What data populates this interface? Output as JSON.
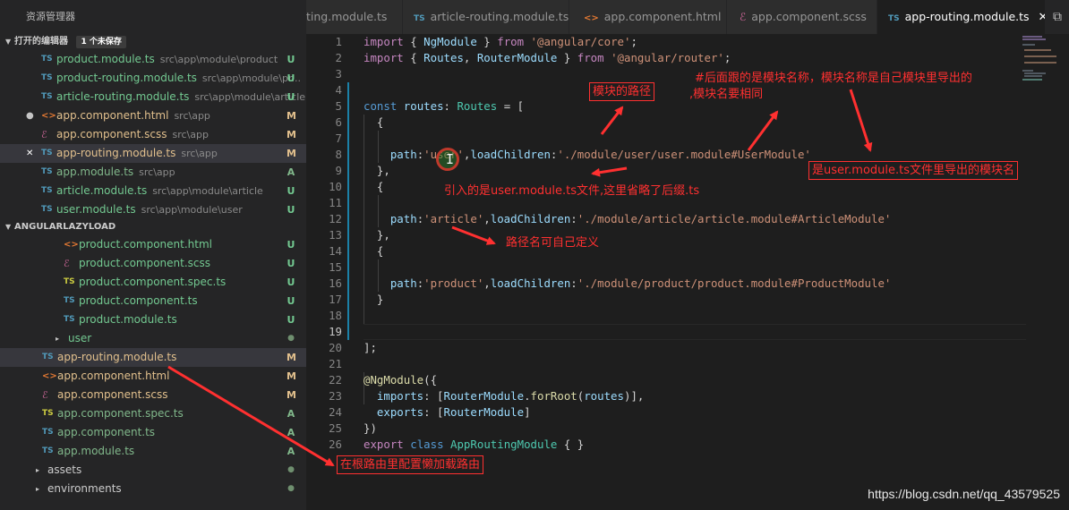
{
  "sidebar": {
    "title": "资源管理器",
    "open_editors": {
      "header": "打开的编辑器",
      "badge": "1 个未保存",
      "items": [
        {
          "icon": "TS",
          "name": "product.module.ts",
          "path": "src\\app\\module\\product",
          "status": "U"
        },
        {
          "icon": "TS",
          "name": "product-routing.module.ts",
          "path": "src\\app\\module\\pr...",
          "status": "U"
        },
        {
          "icon": "TS",
          "name": "article-routing.module.ts",
          "path": "src\\app\\module\\article",
          "status": "U"
        },
        {
          "icon": "<>",
          "mark": "●",
          "name": "app.component.html",
          "path": "src\\app",
          "status": "M"
        },
        {
          "icon": "ℰ",
          "name": "app.component.scss",
          "path": "src\\app",
          "status": "M"
        },
        {
          "icon": "TS",
          "mark": "✕",
          "name": "app-routing.module.ts",
          "path": "src\\app",
          "status": "M"
        },
        {
          "icon": "TS",
          "name": "app.module.ts",
          "path": "src\\app",
          "status": "A"
        },
        {
          "icon": "TS",
          "name": "article.module.ts",
          "path": "src\\app\\module\\article",
          "status": "U"
        },
        {
          "icon": "TS",
          "name": "user.module.ts",
          "path": "src\\app\\module\\user",
          "status": "U"
        }
      ]
    },
    "project": {
      "header": "ANGULARLAZYLOAD",
      "items": [
        {
          "icon": "<>",
          "name": "product.component.html",
          "status": "U"
        },
        {
          "icon": "ℰ",
          "name": "product.component.scss",
          "status": "U"
        },
        {
          "icon": "TS",
          "name": "product.component.spec.ts",
          "status": "U"
        },
        {
          "icon": "TS",
          "name": "product.component.ts",
          "status": "U"
        },
        {
          "icon": "TS",
          "name": "product.module.ts",
          "status": "U"
        },
        {
          "icon": "▸",
          "name": "user",
          "status": "●"
        },
        {
          "icon": "TS",
          "name": "app-routing.module.ts",
          "status": "M"
        },
        {
          "icon": "<>",
          "name": "app.component.html",
          "status": "M"
        },
        {
          "icon": "ℰ",
          "name": "app.component.scss",
          "status": "M"
        },
        {
          "icon": "TS",
          "name": "app.component.spec.ts",
          "status": "A"
        },
        {
          "icon": "TS",
          "name": "app.component.ts",
          "status": "A"
        },
        {
          "icon": "TS",
          "name": "app.module.ts",
          "status": "A"
        },
        {
          "icon": "▸",
          "name": "assets",
          "status": "●"
        },
        {
          "icon": "▸",
          "name": "environments",
          "status": "●"
        }
      ]
    }
  },
  "tabs": [
    {
      "icon": "",
      "label": "ting.module.ts"
    },
    {
      "icon": "TS",
      "label": "article-routing.module.ts"
    },
    {
      "icon": "<>",
      "label": "app.component.html",
      "suffix": "●"
    },
    {
      "icon": "ℰ",
      "label": "app.component.scss"
    },
    {
      "icon": "TS",
      "label": "app-routing.module.ts",
      "suffix": "✕",
      "active": true
    }
  ],
  "editor": {
    "current_line": 19,
    "line_numbers": [
      "1",
      "2",
      "3",
      "4",
      "5",
      "6",
      "7",
      "8",
      "9",
      "10",
      "11",
      "12",
      "13",
      "14",
      "15",
      "16",
      "17",
      "18",
      "19",
      "20",
      "21",
      "22",
      "23",
      "24",
      "25",
      "26"
    ]
  },
  "annotations": {
    "route_path": "模块的路径",
    "module_name_note_1": "#后面跟的是模块名称，模块名称是自己模块里导出的",
    "module_name_note_2": ",模块名要相同",
    "exported_module": "是user.module.ts文件里导出的模块名",
    "import_note": "引入的是user.module.ts文件,这里省略了后缀.ts",
    "path_custom": "路径名可自己定义",
    "root_route": "在根路由里配置懒加载路由"
  },
  "cursor": {
    "glyph": "I"
  },
  "watermark": "https://blog.csdn.net/qq_43579525",
  "colors": {
    "annotation": "#ff3030",
    "keyword": "#569cd6",
    "string": "#ce9178",
    "type": "#4ec9b0"
  }
}
